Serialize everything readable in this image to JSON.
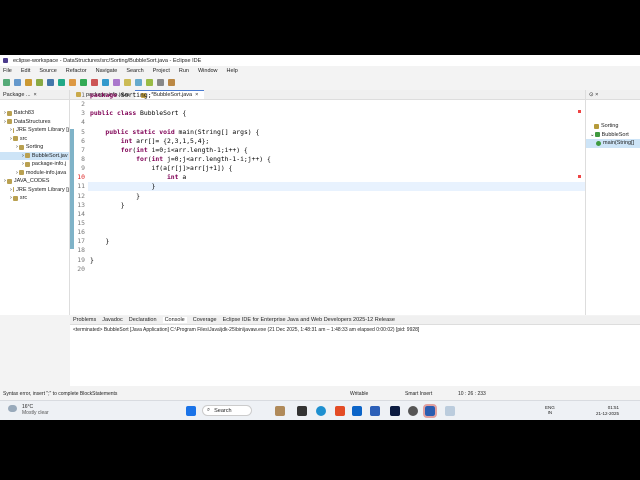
{
  "window": {
    "title": "eclipse-workspace - DataStructures/src/Sorting/BubbleSort.java - Eclipse IDE"
  },
  "menu": [
    "File",
    "Edit",
    "Source",
    "Refactor",
    "Navigate",
    "Search",
    "Project",
    "Run",
    "Window",
    "Help"
  ],
  "package_explorer": {
    "title": "Package ...",
    "tree": [
      {
        "label": "Batch83",
        "indent": 1
      },
      {
        "label": "DataStructures",
        "indent": 1
      },
      {
        "label": "JRE System Library [j",
        "indent": 2
      },
      {
        "label": "src",
        "indent": 2
      },
      {
        "label": "Sorting",
        "indent": 3
      },
      {
        "label": "BubbleSort.jav",
        "indent": 4
      },
      {
        "label": "package-info.j",
        "indent": 4
      },
      {
        "label": "module-info.java",
        "indent": 3
      },
      {
        "label": "JAVA_CODES",
        "indent": 1
      },
      {
        "label": "JRE System Library [j",
        "indent": 2
      },
      {
        "label": "src",
        "indent": 2
      }
    ]
  },
  "editor": {
    "tabs": [
      "package-info.java",
      "*BubbleSort.java"
    ],
    "lines": [
      "package Sorting;",
      "",
      "public class BubbleSort {",
      "",
      "    public static void main(String[] args) {",
      "        int arr[]= {2,3,1,5,4};",
      "        for(int i=0;i<arr.length-1;i++) {",
      "            for(int j=0;j<arr.length-1-i;j++) {",
      "                if(a[r[j]>arr[j+1]) {",
      "                    int a",
      "                }",
      "            }",
      "        }",
      "",
      "",
      "",
      "    }",
      "",
      "}",
      ""
    ],
    "error_line": 10
  },
  "outline": {
    "items": [
      "Sorting",
      "BubbleSort",
      "main(String[]"
    ]
  },
  "console": {
    "tabs": [
      "Problems",
      "Javadoc",
      "Declaration",
      "Console",
      "Coverage",
      "Eclipse IDE for Enterprise Java and Web Developers 2025-12 Release"
    ],
    "output": "<terminated> BubbleSort [Java Application] C:\\Program Files\\Java\\jdk-25\\bin\\javaw.exe  (21 Dec 2025, 1:48:31 am – 1:48:33 am elapsed 0:00:02) [pid: 9928]"
  },
  "status": {
    "message": "Syntax error, insert \";\" to complete BlockStatements",
    "writable": "Writable",
    "insert_mode": "Smart Insert",
    "position": "10 : 26 : 233"
  },
  "taskbar": {
    "weather_temp": "16°C",
    "weather_desc": "Mostly clear",
    "search": "Search",
    "lang": "ENG",
    "region": "IN",
    "time": "01:51",
    "date": "21-12-2025"
  }
}
